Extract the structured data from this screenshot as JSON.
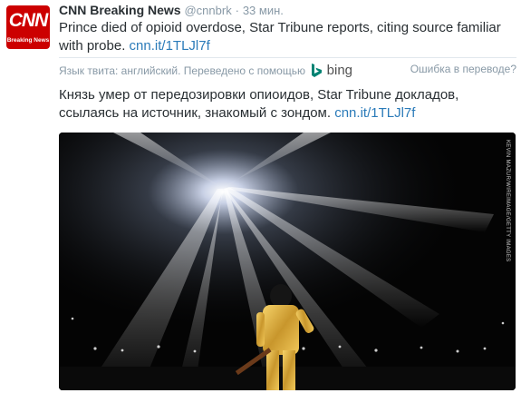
{
  "tweet": {
    "avatar": {
      "logo_text": "CNN",
      "logo_sub": "Breaking News"
    },
    "author_name": "CNN Breaking News",
    "handle": "@cnnbrk",
    "separator": "·",
    "time": "33 мин.",
    "text_en": "Prince died of opioid overdose, Star Tribune reports, citing source familiar with probe.",
    "link_en": "cnn.it/1TLJl7f",
    "translation": {
      "language_label": "Язык твита: английский. Переведено с помощью",
      "provider": "bing",
      "error_label": "Ошибка в переводе?"
    },
    "text_ru": "Князь умер от передозировки опиоидов, Star Tribune докладов, ссылаясь на источник, знакомый с зондом.",
    "link_ru": "cnn.it/1TLJl7f",
    "media": {
      "credit": "KEVIN MAZUR/WIREIMAGE/GETTY IMAGES"
    }
  },
  "colors": {
    "brand_red": "#cc0000",
    "link": "#2b7bb9",
    "muted": "#8899a6",
    "text": "#292f33"
  }
}
